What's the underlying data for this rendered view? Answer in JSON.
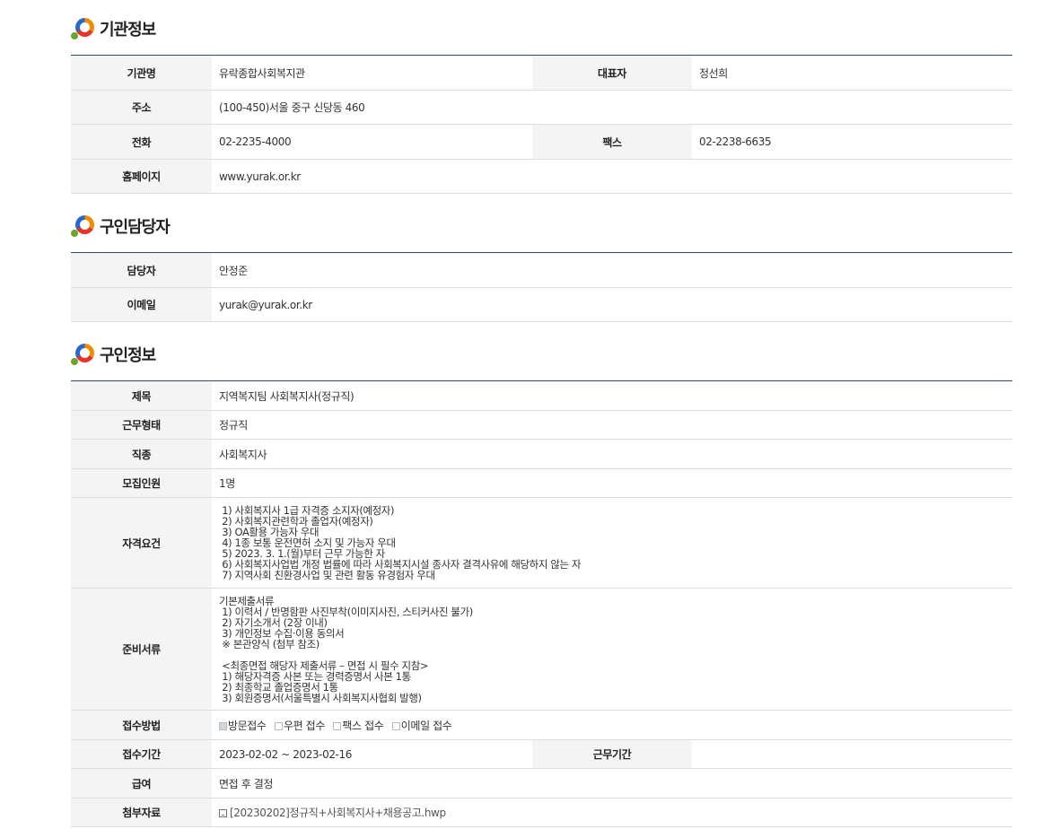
{
  "sections": {
    "institution": {
      "title": "기관정보"
    },
    "recruiter": {
      "title": "구인담당자"
    },
    "job": {
      "title": "구인정보"
    }
  },
  "institution": {
    "name_label": "기관명",
    "name": "유락종합사회복지관",
    "rep_label": "대표자",
    "rep": "정선희",
    "address_label": "주소",
    "address": "(100-450)서울 중구 신당동 460",
    "phone_label": "전화",
    "phone": "02-2235-4000",
    "fax_label": "팩스",
    "fax": "02-2238-6635",
    "homepage_label": "홈페이지",
    "homepage": "www.yurak.or.kr"
  },
  "recruiter": {
    "manager_label": "담당자",
    "manager": "안정준",
    "email_label": "이메일",
    "email": "yurak@yurak.or.kr"
  },
  "job": {
    "title_label": "제목",
    "title": "지역복지팀 사회복지사(정규직)",
    "worktype_label": "근무형태",
    "worktype": "정규직",
    "occupation_label": "직종",
    "occupation": "사회복지사",
    "headcount_label": "모집인원",
    "headcount": "1명",
    "qualification_label": "자격요건",
    "qualification": " 1) 사회복지사 1급 자격증 소지자(예정자)\n 2) 사회복지관련학과 졸업자(예정자)\n 3) OA활용 가능자 우대\n 4) 1종 보통 운전면허 소지 및 가능자 우대\n 5) 2023. 3. 1.(월)부터 근무 가능한 자\n 6) 사회복지사업법 개정 법률에 따라 사회복지시설 종사자 결격사유에 해당하지 않는 자\n 7) 지역사회 친환경사업 및 관련 활동 유경험자 우대",
    "documents_label": "준비서류",
    "documents": "기본제출서류\n 1) 이력서 / 반명함판 사진부착(이미지사진, 스티커사진 불가)\n 2) 자기소개서 (2장 이내)\n 3) 개인정보 수집·이용 동의서\n ※ 본관양식 (첨부 참조)\n\n <최종면접 해당자 제출서류 – 면접 시 필수 지참>\n 1) 해당자격증 사본 또는 경력증명서 사본 1통\n 2) 최종학교 졸업증명서 1통\n 3) 회원증명서(서울특별시 사회복지사협회 발행)",
    "method_label": "접수방법",
    "methods": [
      {
        "label": "방문접수",
        "checked": true
      },
      {
        "label": "우편 접수",
        "checked": false
      },
      {
        "label": "팩스 접수",
        "checked": false
      },
      {
        "label": "이메일 접수",
        "checked": false
      }
    ],
    "period_label": "접수기간",
    "period": "2023-02-02 ~ 2023-02-16",
    "work_period_label": "근무기간",
    "work_period": "",
    "salary_label": "급여",
    "salary": "면접 후 결정",
    "attachment_label": "첨부자료",
    "attachment": "[20230202]정규직+사회복지사+채용공고.hwp",
    "attachment_icon": "file-icon"
  }
}
